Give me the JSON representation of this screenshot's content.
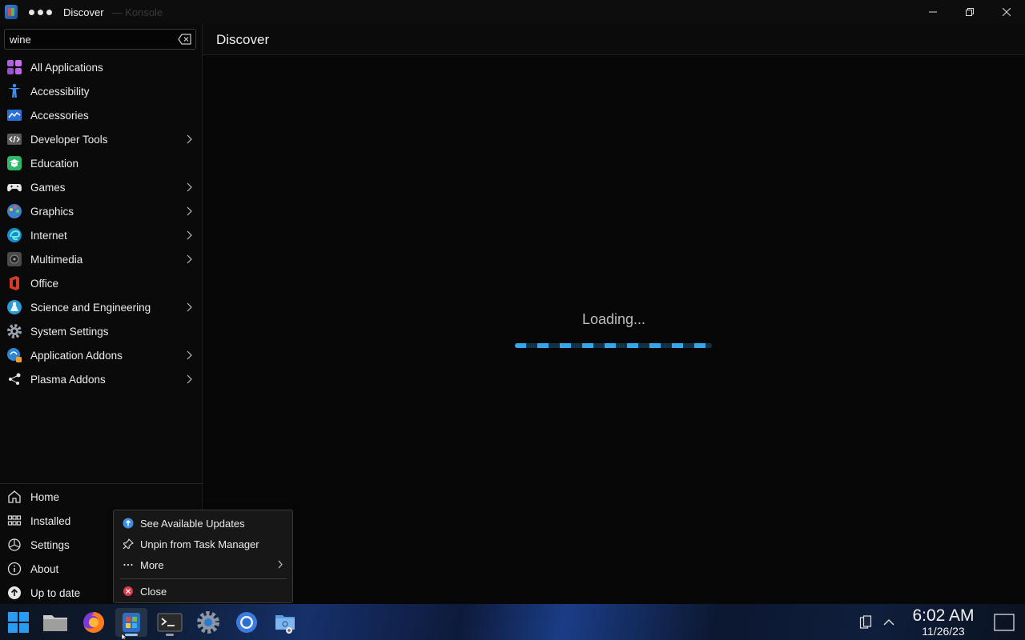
{
  "window": {
    "title": "Discover",
    "ghost_title": "— Konsole"
  },
  "search": {
    "value": "wine",
    "placeholder": ""
  },
  "sidebar": {
    "categories": [
      {
        "label": "All Applications",
        "icon": "grid-apps-icon",
        "has_submenu": false
      },
      {
        "label": "Accessibility",
        "icon": "accessibility-icon",
        "has_submenu": false
      },
      {
        "label": "Accessories",
        "icon": "accessories-icon",
        "has_submenu": false
      },
      {
        "label": "Developer Tools",
        "icon": "developer-tools-icon",
        "has_submenu": true
      },
      {
        "label": "Education",
        "icon": "education-icon",
        "has_submenu": false
      },
      {
        "label": "Games",
        "icon": "gamepad-icon",
        "has_submenu": true
      },
      {
        "label": "Graphics",
        "icon": "graphics-icon",
        "has_submenu": true
      },
      {
        "label": "Internet",
        "icon": "internet-icon",
        "has_submenu": true
      },
      {
        "label": "Multimedia",
        "icon": "multimedia-icon",
        "has_submenu": true
      },
      {
        "label": "Office",
        "icon": "office-icon",
        "has_submenu": false
      },
      {
        "label": "Science and Engineering",
        "icon": "science-icon",
        "has_submenu": true
      },
      {
        "label": "System Settings",
        "icon": "system-settings-icon",
        "has_submenu": false
      },
      {
        "label": "Application Addons",
        "icon": "application-addons-icon",
        "has_submenu": true
      },
      {
        "label": "Plasma Addons",
        "icon": "plasma-addons-icon",
        "has_submenu": true
      }
    ],
    "bottom": [
      {
        "label": "Home",
        "icon": "home-icon"
      },
      {
        "label": "Installed",
        "icon": "installed-icon"
      },
      {
        "label": "Settings",
        "icon": "settings-icon"
      },
      {
        "label": "About",
        "icon": "info-icon"
      },
      {
        "label": "Up to date",
        "icon": "up-to-date-icon"
      }
    ]
  },
  "main": {
    "title": "Discover",
    "loading_text": "Loading..."
  },
  "context_menu": {
    "items": [
      {
        "label": "See Available Updates",
        "icon": "update-icon"
      },
      {
        "label": "Unpin from Task Manager",
        "icon": "pin-icon"
      },
      {
        "label": "More",
        "icon": "more-icon"
      },
      {
        "label": "Close",
        "icon": "close-circle-icon"
      }
    ]
  },
  "taskbar": {
    "apps": [
      {
        "name": "start-menu-icon"
      },
      {
        "name": "file-manager-icon"
      },
      {
        "name": "firefox-icon"
      },
      {
        "name": "discover-icon"
      },
      {
        "name": "konsole-icon"
      },
      {
        "name": "system-settings-taskbar-icon"
      },
      {
        "name": "chromium-icon"
      },
      {
        "name": "software-center-icon"
      }
    ],
    "clock": {
      "time": "6:02 AM",
      "date": "11/26/23"
    }
  },
  "colors": {
    "accent": "#3daee9",
    "background": "#070707",
    "sidebar": "#0a0a0a"
  }
}
